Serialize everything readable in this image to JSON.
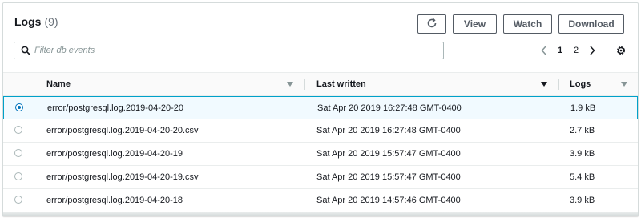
{
  "header": {
    "title": "Logs",
    "count": "(9)"
  },
  "toolbar": {
    "refresh_icon": "refresh-icon",
    "view_label": "View",
    "watch_label": "Watch",
    "download_label": "Download"
  },
  "search": {
    "placeholder": "Filter db events",
    "value": ""
  },
  "pagination": {
    "pages": [
      "1",
      "2"
    ],
    "current": "1"
  },
  "columns": [
    {
      "label": "Name",
      "sort": "none"
    },
    {
      "label": "Last written",
      "sort": "descending"
    },
    {
      "label": "Logs",
      "sort": "none"
    }
  ],
  "rows": [
    {
      "name": "error/postgresql.log.2019-04-20-20",
      "last_written": "Sat Apr 20 2019 16:27:48 GMT-0400",
      "size": "1.9 kB",
      "selected": true
    },
    {
      "name": "error/postgresql.log.2019-04-20-20.csv",
      "last_written": "Sat Apr 20 2019 16:27:48 GMT-0400",
      "size": "2.7 kB",
      "selected": false
    },
    {
      "name": "error/postgresql.log.2019-04-20-19",
      "last_written": "Sat Apr 20 2019 15:57:47 GMT-0400",
      "size": "3.9 kB",
      "selected": false
    },
    {
      "name": "error/postgresql.log.2019-04-20-19.csv",
      "last_written": "Sat Apr 20 2019 15:57:47 GMT-0400",
      "size": "5.4 kB",
      "selected": false
    },
    {
      "name": "error/postgresql.log.2019-04-20-18",
      "last_written": "Sat Apr 20 2019 14:57:46 GMT-0400",
      "size": "3.9 kB",
      "selected": false
    }
  ],
  "colors": {
    "accent": "#0073bb",
    "selected_row_bg": "#f1faff",
    "selected_row_border": "#00a1c9"
  }
}
